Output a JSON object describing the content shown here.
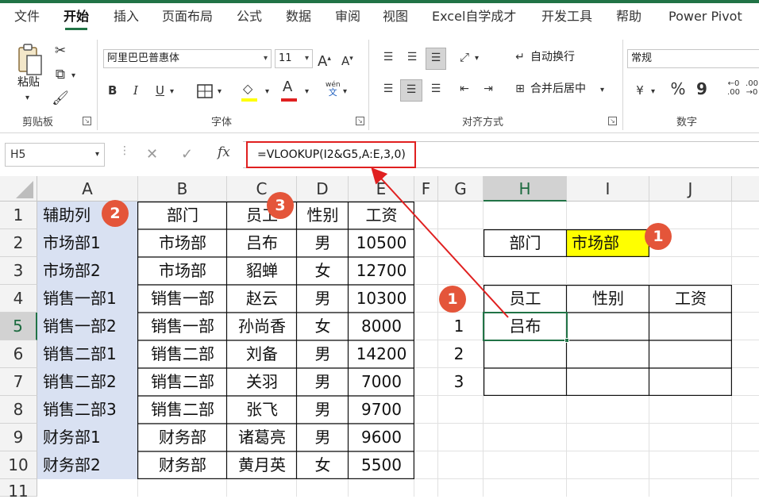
{
  "menu": {
    "tabs": [
      "文件",
      "开始",
      "插入",
      "页面布局",
      "公式",
      "数据",
      "审阅",
      "视图",
      "Excel自学成才",
      "开发工具",
      "帮助",
      "Power Pivot"
    ],
    "active": "开始"
  },
  "ribbon": {
    "clipboard": {
      "label": "剪贴板",
      "paste_label": "粘贴"
    },
    "font": {
      "label": "字体",
      "font_name": "阿里巴巴普惠体",
      "font_size": "11",
      "bold": "B",
      "italic": "I",
      "underline": "U",
      "grow": "A",
      "shrink": "A",
      "color_letter": "A",
      "phonetic_top": "wén",
      "phonetic_bottom": "文",
      "font_color": "#e02020"
    },
    "alignment": {
      "label": "对齐方式",
      "wrap_text": "自动换行",
      "merge_center": "合并后居中"
    },
    "number": {
      "label": "数字",
      "format": "常规",
      "percent": "%",
      "comma": "9"
    }
  },
  "formula_bar": {
    "name_box": "H5",
    "cancel": "✕",
    "enter": "✓",
    "fx": "fx",
    "formula": "=VLOOKUP(I2&G5,A:E,3,0)"
  },
  "sheet": {
    "columns": [
      "A",
      "B",
      "C",
      "D",
      "E",
      "F",
      "G",
      "H",
      "I",
      "J"
    ],
    "rows": [
      "1",
      "2",
      "3",
      "4",
      "5",
      "6",
      "7",
      "8",
      "9",
      "10",
      "11"
    ],
    "selected_col": "H",
    "selected_row": "5",
    "helper_col": [
      "辅助列",
      "市场部1",
      "市场部2",
      "销售一部1",
      "销售一部2",
      "销售二部1",
      "销售二部2",
      "销售二部3",
      "财务部1",
      "财务部2"
    ],
    "table": {
      "headers": [
        "部门",
        "员工",
        "性别",
        "工资"
      ],
      "rows": [
        [
          "市场部",
          "吕布",
          "男",
          "10500"
        ],
        [
          "市场部",
          "貂蝉",
          "女",
          "12700"
        ],
        [
          "销售一部",
          "赵云",
          "男",
          "10300"
        ],
        [
          "销售一部",
          "孙尚香",
          "女",
          "8000"
        ],
        [
          "销售二部",
          "刘备",
          "男",
          "14200"
        ],
        [
          "销售二部",
          "关羽",
          "男",
          "7000"
        ],
        [
          "销售二部",
          "张飞",
          "男",
          "9700"
        ],
        [
          "财务部",
          "诸葛亮",
          "男",
          "9600"
        ],
        [
          "财务部",
          "黄月英",
          "女",
          "5500"
        ]
      ]
    },
    "lookup": {
      "dept_label": "部门",
      "dept_value": "市场部",
      "headers": [
        "员工",
        "性别",
        "工资"
      ],
      "index": [
        "1",
        "2",
        "3"
      ],
      "result_h5": "吕布"
    },
    "highlight_color": "#ffff00",
    "helper_fill": "#d9e1f2"
  },
  "badges": {
    "helper": "2",
    "employee": "3",
    "dept": "1",
    "index": "1"
  },
  "accent": "#217346",
  "badge_color": "#e4553a"
}
